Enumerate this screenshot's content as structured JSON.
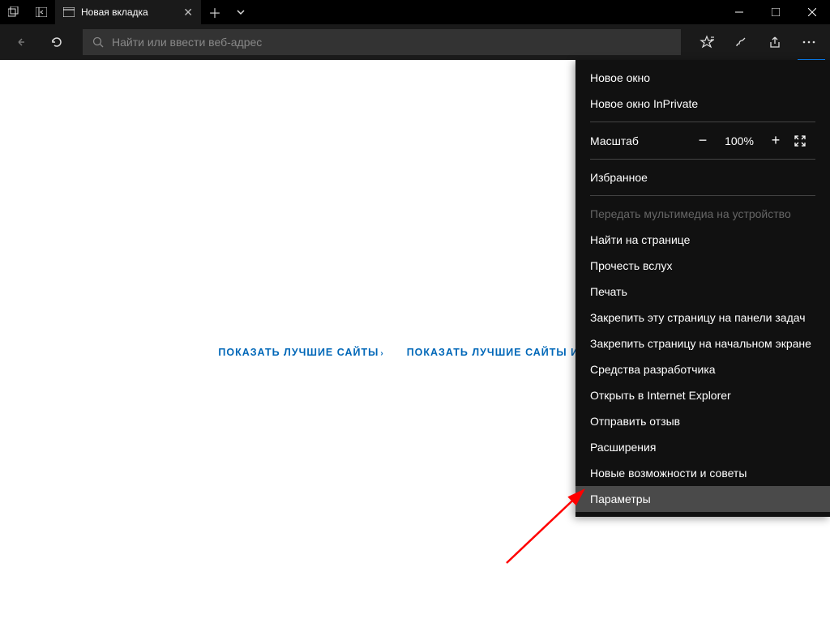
{
  "tab": {
    "title": "Новая вкладка"
  },
  "addressbar": {
    "placeholder": "Найти или ввести веб-адрес"
  },
  "content": {
    "link1": "ПОКАЗАТЬ ЛУЧШИЕ САЙТЫ",
    "link2": "ПОКАЗАТЬ ЛУЧШИЕ САЙТЫ И МОЮ"
  },
  "menu": {
    "new_window": "Новое окно",
    "inprivate": "Новое окно InPrivate",
    "zoom_label": "Масштаб",
    "zoom_value": "100%",
    "favorites": "Избранное",
    "cast": "Передать мультимедиа на устройство",
    "find": "Найти на странице",
    "read_aloud": "Прочесть вслух",
    "print": "Печать",
    "pin_taskbar": "Закрепить эту страницу на панели задач",
    "pin_start": "Закрепить страницу на начальном экране",
    "dev_tools": "Средства разработчика",
    "open_ie": "Открыть в Internet Explorer",
    "feedback": "Отправить отзыв",
    "extensions": "Расширения",
    "whats_new": "Новые возможности и советы",
    "settings": "Параметры"
  }
}
